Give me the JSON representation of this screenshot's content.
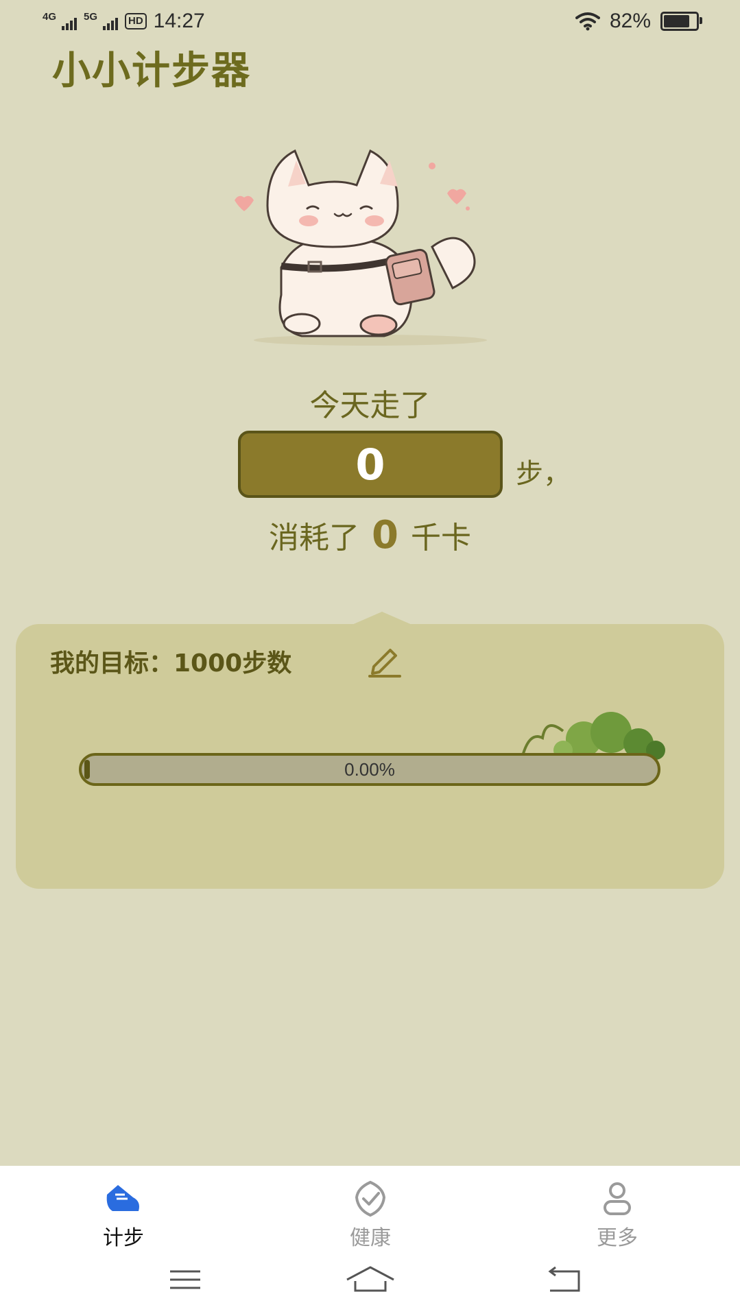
{
  "status_bar": {
    "net1": "4G",
    "net2": "5G",
    "hd": "HD",
    "time": "14:27",
    "battery_pct": "82%",
    "battery_level": 0.82
  },
  "app": {
    "title": "小小计步器"
  },
  "today": {
    "label": "今天走了",
    "steps": "0",
    "steps_unit": "步，",
    "cal_prefix": "消耗了",
    "cal_value": "0",
    "cal_unit": "千卡"
  },
  "goal": {
    "title": "我的目标：1000步数",
    "progress_text": "0.00%",
    "progress_fraction": 0.0
  },
  "tabs": [
    {
      "label": "计步",
      "icon": "shoe-icon",
      "active": true
    },
    {
      "label": "健康",
      "icon": "shield-check-icon",
      "active": false
    },
    {
      "label": "更多",
      "icon": "person-icon",
      "active": false
    }
  ],
  "colors": {
    "background": "#dcdabf",
    "accent": "#8b7a2b",
    "card": "#cfcb9a",
    "tab_active": "#2a6cdf"
  }
}
